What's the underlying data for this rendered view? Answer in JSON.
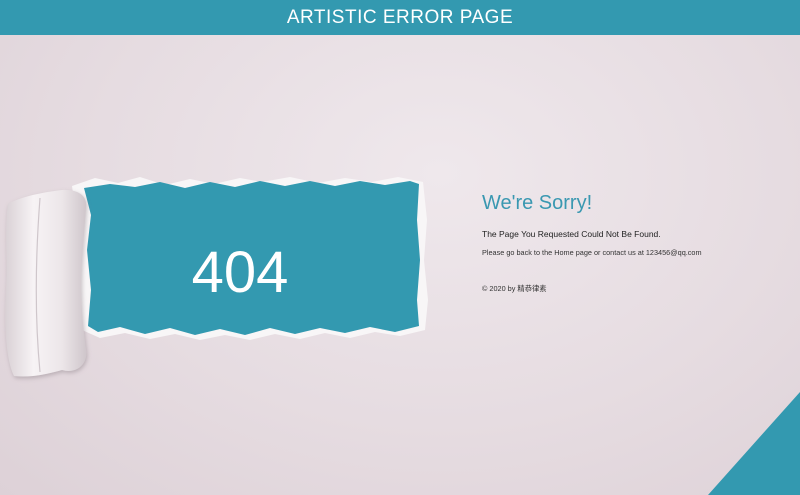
{
  "header": {
    "title": "ARTISTIC ERROR PAGE"
  },
  "error": {
    "code": "404"
  },
  "message": {
    "title": "We're Sorry!",
    "subtitle": "The Page You Requested Could Not Be Found.",
    "help": "Please go back to the Home page or contact us at 123456@qq.com",
    "footer": "© 2020 by 精恭律素"
  },
  "colors": {
    "accent": "#3399b0",
    "background": "#e4d9de",
    "title": "#3a98b1"
  }
}
